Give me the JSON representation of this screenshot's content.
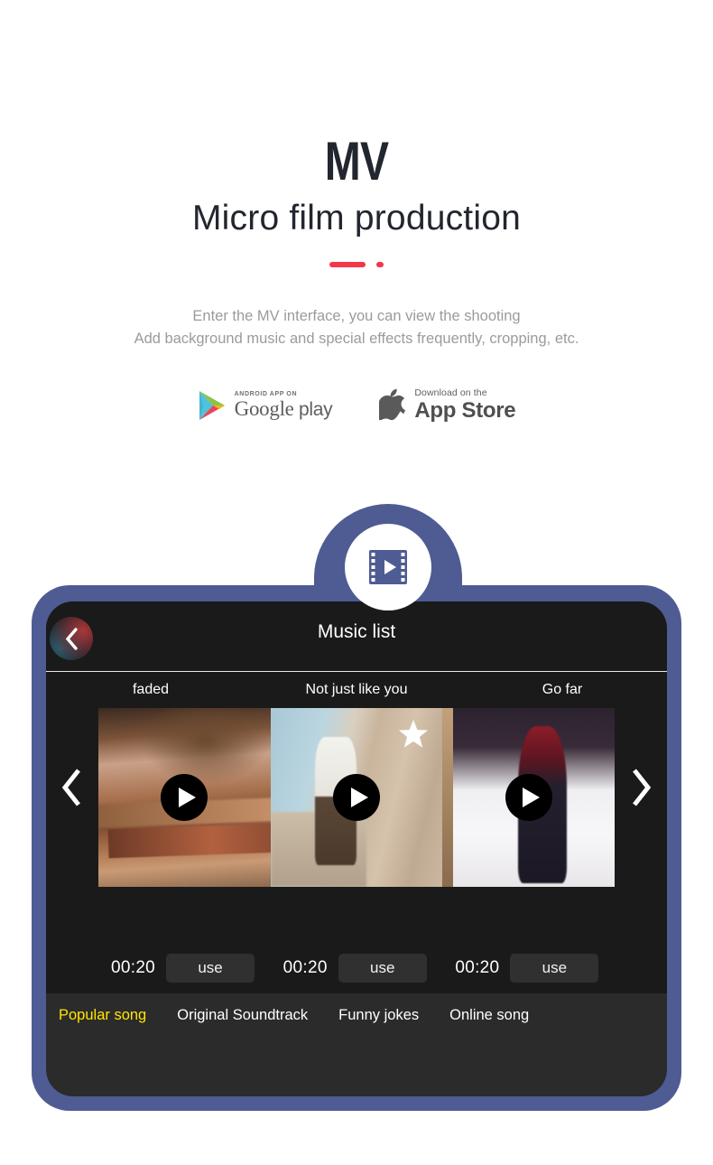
{
  "hero": {
    "title": "MV",
    "subtitle": "Micro film production",
    "description_line1": "Enter the MV interface, you can view the shooting",
    "description_line2": "Add background music and special effects frequently, cropping, etc.",
    "accent_color": "#f43648",
    "title_color": "#22262e",
    "description_color": "#9b9b9b"
  },
  "store_badges": [
    {
      "id": "google-play",
      "icon": "google-play-triangle-icon",
      "small_label": "ANDROID APP ON",
      "big_label": "Google",
      "big_label_suffix": "play"
    },
    {
      "id": "app-store",
      "icon": "apple-logo-icon",
      "small_label": "Download on the",
      "big_label": "App Store"
    }
  ],
  "mock": {
    "frame_color": "#4e5c93",
    "screen_color": "#1a1a1a",
    "panel_color": "#2b2b2b",
    "badge_icon": "film-strip-play-icon",
    "header": {
      "title": "Music list",
      "back_icon": "chevron-left-icon"
    },
    "carousel": {
      "prev_icon": "chevron-left-icon",
      "next_icon": "chevron-right-icon",
      "items": [
        {
          "title": "faded",
          "duration": "00:20",
          "use_label": "use",
          "play_icon": "play-icon",
          "starred": false,
          "thumbnail": "books-and-nest-photo"
        },
        {
          "title": "Not just like you",
          "duration": "00:20",
          "use_label": "use",
          "play_icon": "play-icon",
          "starred": true,
          "star_icon": "star-icon",
          "thumbnail": "boy-at-stone-wall-photo"
        },
        {
          "title": "Go far",
          "duration": "00:20",
          "use_label": "use",
          "play_icon": "play-icon",
          "starred": false,
          "thumbnail": "woman-in-snow-photo"
        }
      ]
    },
    "tabs": [
      {
        "label": "Popular song",
        "active": true,
        "active_color": "#ffe600"
      },
      {
        "label": "Original Soundtrack",
        "active": false
      },
      {
        "label": "Funny jokes",
        "active": false
      },
      {
        "label": "Online song",
        "active": false
      }
    ]
  }
}
